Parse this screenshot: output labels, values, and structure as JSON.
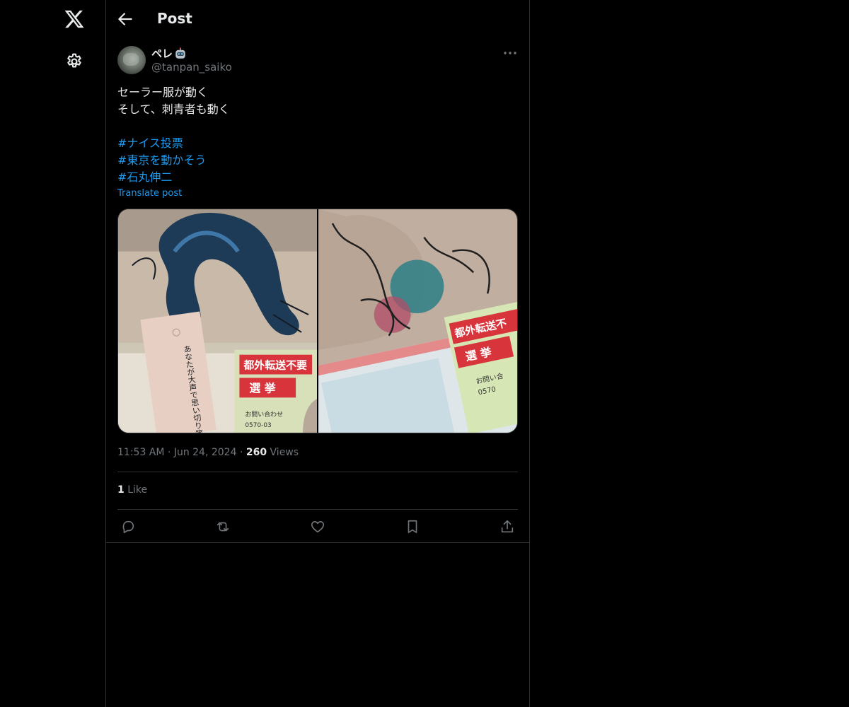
{
  "nav": {
    "logo_icon": "x-logo-icon",
    "settings_icon": "gear-icon"
  },
  "header": {
    "title": "Post",
    "back_icon": "arrow-left-icon"
  },
  "post": {
    "author": {
      "name": "ペレ",
      "name_emoji": "robot-icon",
      "handle": "@tanpan_saiko"
    },
    "text_lines": [
      "セーラー服が動く",
      "そして、刺青者も動く"
    ],
    "hashtags": [
      "#ナイス投票",
      "#東京を動かそう",
      "#石丸伸二"
    ],
    "translate_label": "Translate post",
    "media": [
      {
        "alt": "dragon-tattoo-photo-with-ballot-envelope",
        "envelope_text": [
          "都外転送不要",
          "選 挙",
          "お問い合わせ",
          "0570-03"
        ],
        "card_text": "あなたが大声で思い切り笑える"
      },
      {
        "alt": "wolf-tattoo-photo-with-ballot-envelope",
        "envelope_text": [
          "都外転送不",
          "選 挙",
          "お問い合",
          "0570"
        ]
      }
    ],
    "time": "11:53 AM",
    "date": "Jun 24, 2024",
    "separator": "·",
    "views_count": "260",
    "views_label": "Views",
    "likes_count": "1",
    "likes_label": "Like"
  },
  "actions": [
    "reply-icon",
    "repost-icon",
    "like-icon",
    "bookmark-icon",
    "share-icon"
  ],
  "colors": {
    "background": "#000000",
    "text": "#e7e9ea",
    "secondary": "#71767b",
    "accent": "#1d9bf0",
    "border": "#2f3336"
  }
}
